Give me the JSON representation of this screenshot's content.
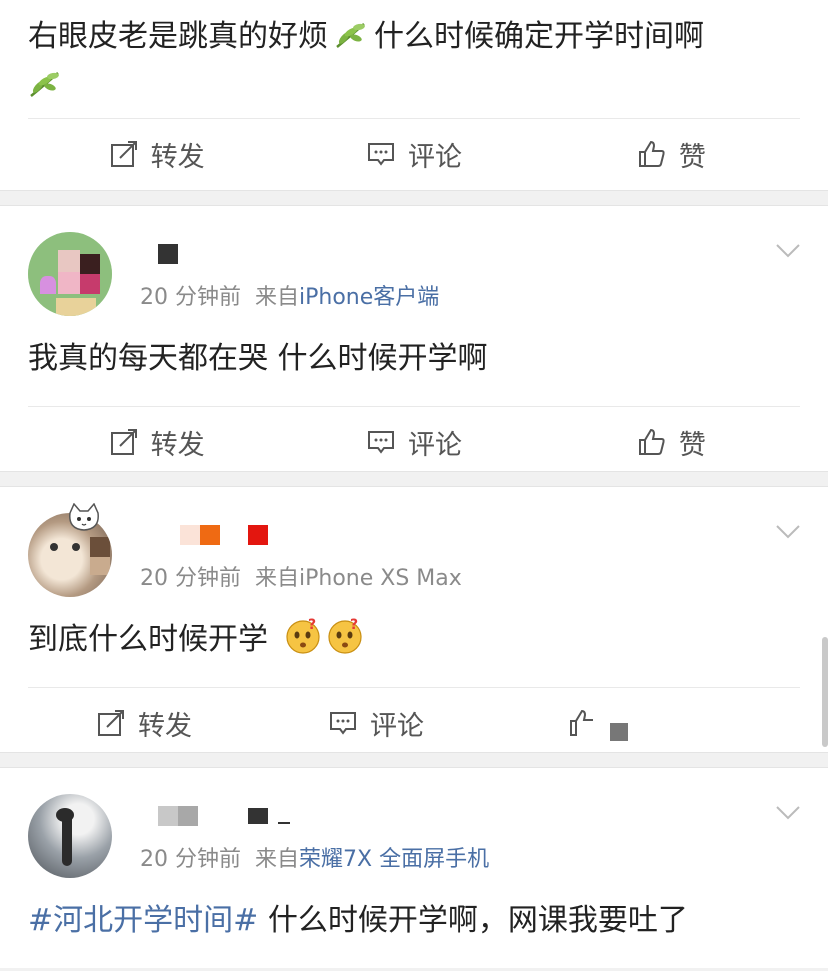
{
  "posts": [
    {
      "text_a": "右眼皮老是跳真的好烦",
      "text_b": "什么时候确定开学时间啊",
      "actions": {
        "repost": "转发",
        "comment": "评论",
        "like": "赞"
      }
    },
    {
      "time": "20 分钟前",
      "from": "来自",
      "source": "iPhone客户端",
      "text": "我真的每天都在哭 什么时候开学啊",
      "actions": {
        "repost": "转发",
        "comment": "评论",
        "like": "赞"
      }
    },
    {
      "time": "20 分钟前",
      "from": "来自",
      "source": "iPhone XS Max",
      "text": "到底什么时候开学",
      "actions": {
        "repost": "转发",
        "comment": "评论"
      }
    },
    {
      "time": "20 分钟前",
      "from": "来自",
      "source": "荣耀7X 全面屏手机",
      "topic": "#河北开学时间#",
      "text": " 什么时候开学啊，网课我要吐了"
    }
  ],
  "colors": {
    "link": "#4a6fa5",
    "meta": "#8a8a8a",
    "text": "#222222",
    "background": "#f1f1f1"
  },
  "icons": [
    "leaf-emoji-icon",
    "repost-icon",
    "comment-icon",
    "like-icon",
    "chevron-down-icon",
    "puzzled-face-emoji-icon"
  ]
}
